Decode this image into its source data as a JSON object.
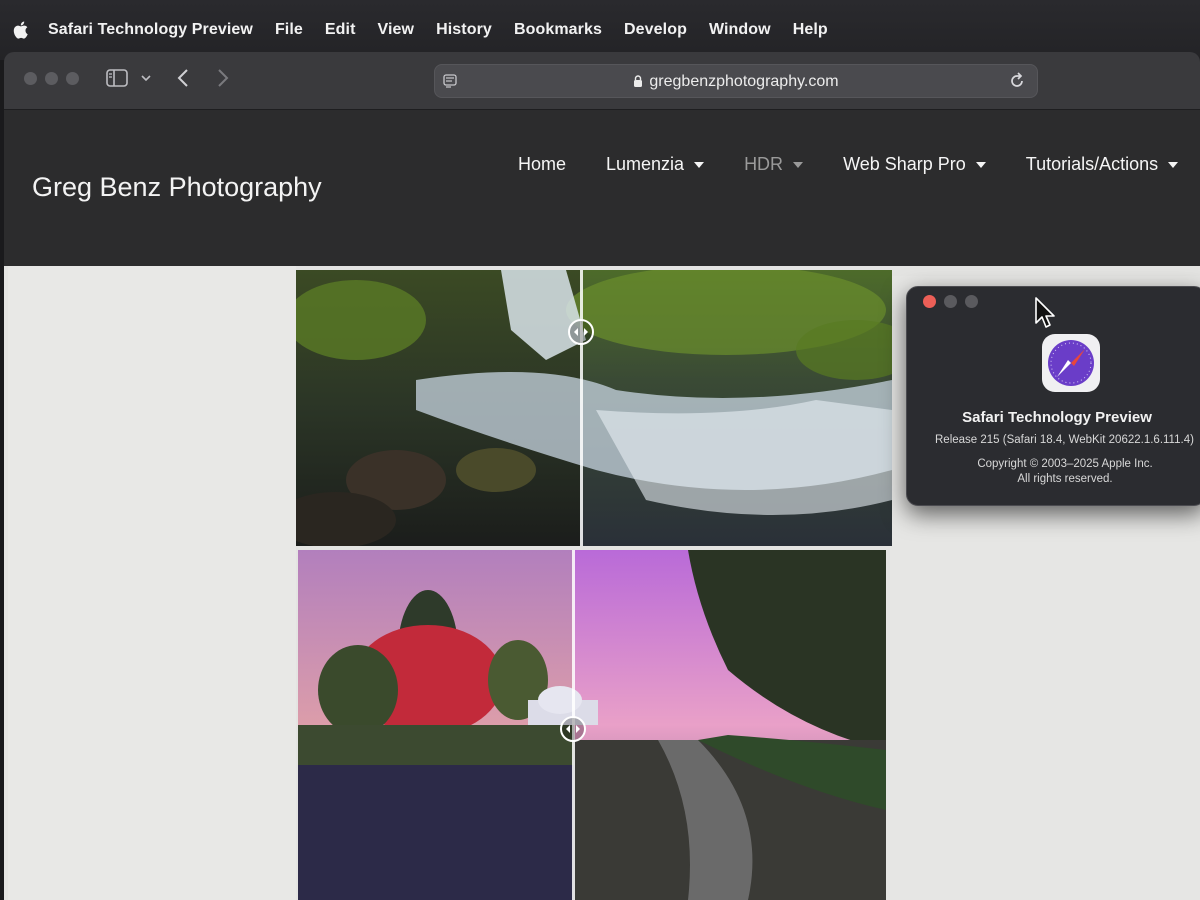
{
  "menubar": {
    "app_name": "Safari Technology Preview",
    "items": [
      "File",
      "Edit",
      "View",
      "History",
      "Bookmarks",
      "Develop",
      "Window",
      "Help"
    ]
  },
  "browser": {
    "url": "gregbenzphotography.com"
  },
  "site": {
    "title": "Greg Benz Photography",
    "nav": [
      {
        "label": "Home",
        "dropdown": false,
        "dim": false
      },
      {
        "label": "Lumenzia",
        "dropdown": true,
        "dim": false
      },
      {
        "label": "HDR",
        "dropdown": true,
        "dim": true
      },
      {
        "label": "Web Sharp Pro",
        "dropdown": true,
        "dim": false
      },
      {
        "label": "Tutorials/Actions",
        "dropdown": true,
        "dim": false
      }
    ]
  },
  "about_window": {
    "app_name": "Safari Technology Preview",
    "release": "Release 215 (Safari 18.4, WebKit 20622.1.6.111.4)",
    "copyright": "Copyright © 2003–2025 Apple Inc.",
    "rights": "All rights reserved."
  },
  "colors": {
    "menubar": "#2a2a2e",
    "header": "#2c2c2d",
    "close": "#ec5f57",
    "page_bg": "#e4e4e2"
  }
}
